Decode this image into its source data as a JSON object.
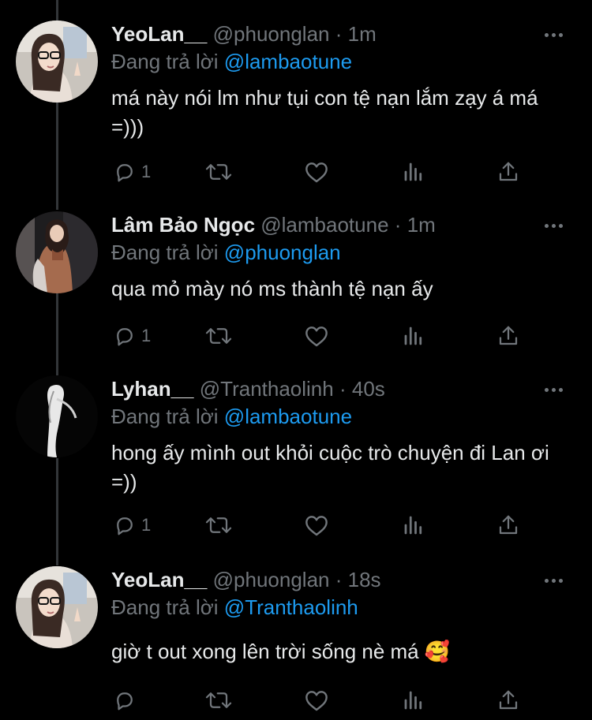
{
  "tweets": [
    {
      "name": "YeoLan__",
      "handle": "@phuonglan",
      "separator": "·",
      "time": "1m",
      "reply_prefix": "Đang trả lời",
      "reply_mention": "@lambaotune",
      "text": "má này nói lm như tụi con tệ nạn lắm zạy á má =)))",
      "reply_count": "1"
    },
    {
      "name": "Lâm Bảo Ngọc",
      "handle": "@lambaotune",
      "separator": "·",
      "time": "1m",
      "reply_prefix": "Đang trả lời",
      "reply_mention": "@phuonglan",
      "text": "qua mỏ mày nó ms thành tệ nạn ấy",
      "reply_count": "1"
    },
    {
      "name": "Lyhan__",
      "handle": "@Tranthaolinh",
      "separator": "·",
      "time": "40s",
      "reply_prefix": "Đang trả lời",
      "reply_mention": "@lambaotune",
      "text": "hong ấy mình out khỏi cuộc trò chuyện đi Lan ơi =))",
      "reply_count": "1"
    },
    {
      "name": "YeoLan__",
      "handle": "@phuonglan",
      "separator": "·",
      "time": "18s",
      "reply_prefix": "Đang trả lời",
      "reply_mention": "@Tranthaolinh",
      "text": "giờ t out xong lên trời sống nè má 🥰",
      "reply_count": ""
    }
  ],
  "colors": {
    "background": "#000000",
    "primary_text": "#e7e9ea",
    "secondary_text": "#71767b",
    "mention": "#1d9bf0",
    "thread_line": "#333639"
  },
  "icons": [
    "reply-icon",
    "retweet-icon",
    "like-icon",
    "views-icon",
    "share-icon",
    "more-icon"
  ]
}
